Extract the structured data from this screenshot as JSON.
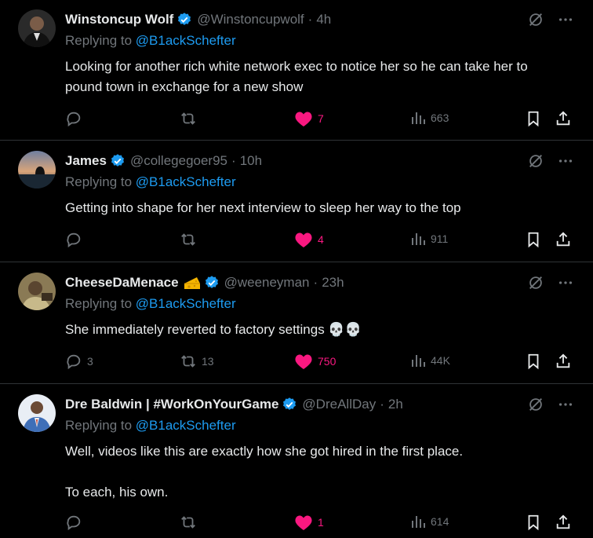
{
  "replies": [
    {
      "name": "Winstoncup Wolf",
      "emoji": "",
      "handle": "@Winstoncupwolf",
      "time": "4h",
      "replying_label": "Replying to",
      "replying_to": "@B1ackSchefter",
      "text": [
        "Looking for another rich white network exec to notice her so he can take her to pound town in exchange for a new show"
      ],
      "replies": "",
      "reposts": "",
      "likes": "7",
      "views": "663"
    },
    {
      "name": "James",
      "emoji": "",
      "handle": "@collegegoer95",
      "time": "10h",
      "replying_label": "Replying to",
      "replying_to": "@B1ackSchefter",
      "text": [
        "Getting into shape for her next interview to sleep her way to the top"
      ],
      "replies": "",
      "reposts": "",
      "likes": "4",
      "views": "911"
    },
    {
      "name": "CheeseDaMenace",
      "emoji": "cheese-emoji",
      "handle": "@weeneyman",
      "time": "23h",
      "replying_label": "Replying to",
      "replying_to": "@B1ackSchefter",
      "text": [
        "She immediately reverted to factory settings 💀💀"
      ],
      "replies": "3",
      "reposts": "13",
      "likes": "750",
      "views": "44K"
    },
    {
      "name": "Dre Baldwin | #WorkOnYourGame",
      "emoji": "",
      "handle": "@DreAllDay",
      "time": "2h",
      "replying_label": "Replying to",
      "replying_to": "@B1ackSchefter",
      "text": [
        "Well, videos like this are exactly how she got hired in the first place.",
        "To each, his own."
      ],
      "replies": "",
      "reposts": "",
      "likes": "1",
      "views": "614"
    }
  ],
  "colors": {
    "background": "#000000",
    "text": "#e7e9ea",
    "muted": "#71767b",
    "accent": "#1d9bf0",
    "like": "#f91880",
    "divider": "#2f3336"
  }
}
